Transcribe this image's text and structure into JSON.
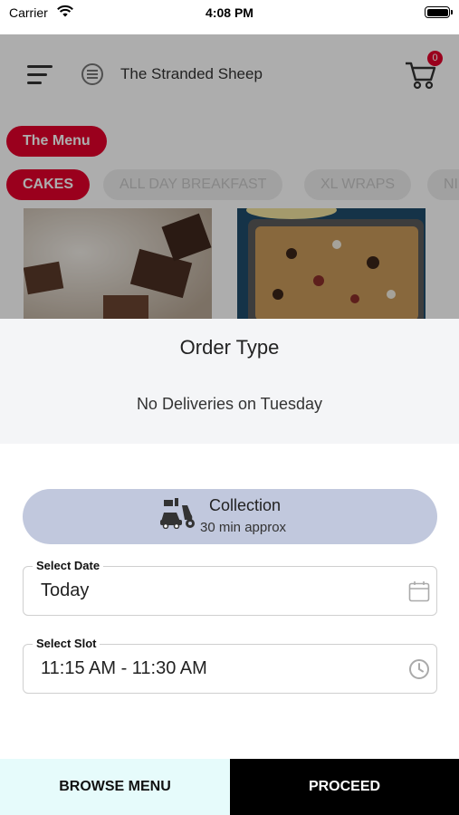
{
  "status_bar": {
    "carrier": "Carrier",
    "time": "4:08 PM"
  },
  "header": {
    "shop_name": "The Stranded Sheep",
    "cart_count": "0"
  },
  "menu": {
    "title": "The Menu",
    "categories": [
      "CAKES",
      "ALL DAY BREAKFAST",
      "XL WRAPS",
      "NI"
    ],
    "active_category": "CAKES"
  },
  "modal": {
    "title": "Order Type",
    "notice": "No Deliveries on Tuesday",
    "collection": {
      "label": "Collection",
      "time": "30 min approx"
    },
    "date_field": {
      "label": "Select Date",
      "value": "Today"
    },
    "slot_field": {
      "label": "Select Slot",
      "value": "11:15 AM - 11:30 AM"
    }
  },
  "bottom": {
    "browse_label": "BROWSE MENU",
    "proceed_label": "PROCEED"
  },
  "colors": {
    "accent": "#e4002b",
    "collection_bg": "#c1c8dd",
    "proceed_bg": "#000000",
    "browse_bg": "#e6fbfb"
  },
  "icons": [
    "wifi-icon",
    "battery-icon",
    "hamburger-menu-icon",
    "shop-logo-icon",
    "cart-icon",
    "collection-car-icon",
    "calendar-icon",
    "clock-icon"
  ]
}
